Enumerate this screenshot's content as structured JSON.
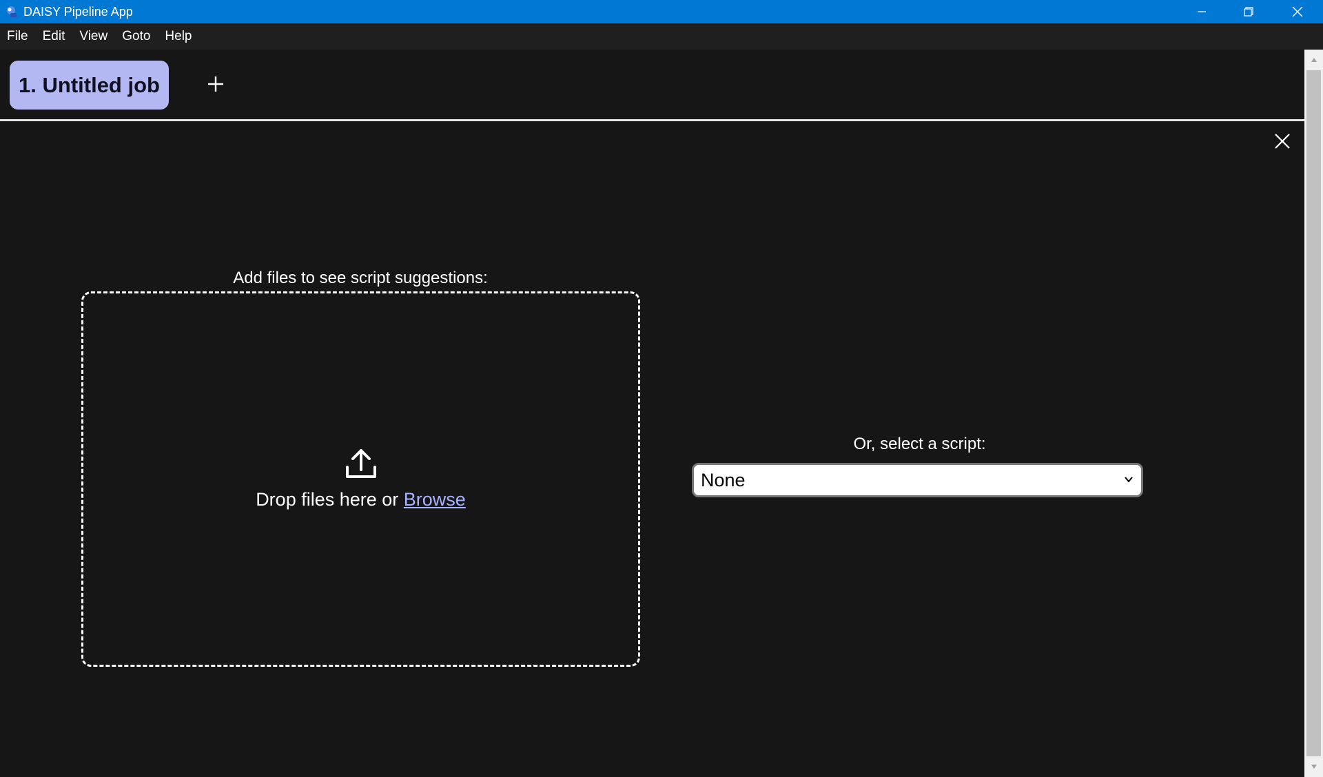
{
  "window": {
    "title": "DAISY Pipeline App",
    "icon": "daisy-app-icon",
    "controls": [
      "minimize-icon",
      "restore-icon",
      "close-icon"
    ]
  },
  "menu": {
    "items": [
      "File",
      "Edit",
      "View",
      "Goto",
      "Help"
    ]
  },
  "tabs": {
    "items": [
      {
        "label": "1. Untitled job",
        "active": true
      }
    ],
    "add_icon": "plus-icon"
  },
  "job": {
    "close_icon": "close-icon",
    "drop_heading": "Add files to see script suggestions:",
    "drop_text": "Drop files here or ",
    "browse_label": "Browse",
    "upload_icon": "upload-icon",
    "select_heading": "Or, select a script:",
    "script_select": {
      "selected": "None"
    }
  },
  "colors": {
    "titlebar": "#0078d4",
    "tab_active": "#b4b8f2",
    "link": "#a8b2ff",
    "background": "#161616"
  }
}
